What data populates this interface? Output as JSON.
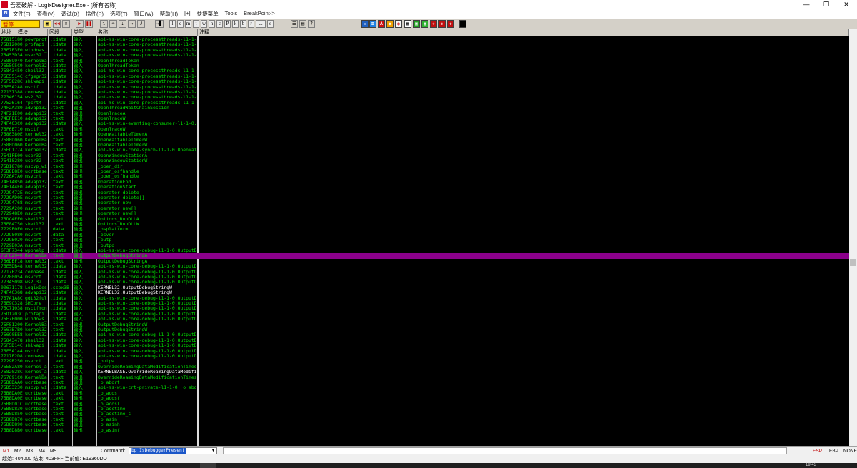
{
  "window": {
    "title": "吾爱破解 - LogixDesigner.Exe - [所有名称]",
    "minimize": "—",
    "maximize": "❐",
    "close": "✕"
  },
  "menu": {
    "logo": "N",
    "items": [
      "文件(F)",
      "查看(V)",
      "调试(D)",
      "插件(P)",
      "选项(T)",
      "窗口(W)",
      "帮助(H)",
      "[+]",
      "快捷菜单",
      "Tools",
      "BreakPoint->"
    ]
  },
  "toolbar": {
    "status": "暂停",
    "letters": [
      "l",
      "e",
      "m",
      "t",
      "w",
      "h",
      "c",
      "P",
      "k",
      "b",
      "r",
      "...",
      "s"
    ]
  },
  "columns": {
    "address": "地址",
    "module": "模块",
    "section": "区段",
    "type": "类型",
    "name": "名称",
    "comment": "注释"
  },
  "rows": [
    {
      "addr": "75815180",
      "mod": "powrprof",
      "sect": ".idata",
      "type": "输入",
      "name": "api-ms-win-core-processthreads-l1-1-0."
    },
    {
      "addr": "75D12000",
      "mod": "profapi",
      "sect": ".idata",
      "type": "输入",
      "name": "api-ms-win-core-processthreads-l1-1-0."
    },
    {
      "addr": "75E7F3F0",
      "mod": "windows_",
      "sect": ".idata",
      "type": "输入",
      "name": "api-ms-win-core-processthreads-l1-1-0."
    },
    {
      "addr": "75453D34",
      "mod": "user32",
      "sect": ".idata",
      "type": "输入",
      "name": "api-ms-win-core-processthreads-l1-1-0."
    },
    {
      "addr": "75809940",
      "mod": "KernelBa",
      "sect": ".text",
      "type": "输出",
      "name": "OpenThreadToken"
    },
    {
      "addr": "75E5C5C9",
      "mod": "kernel32",
      "sect": ".idata",
      "type": "输入",
      "name": "OpenThreadToken"
    },
    {
      "addr": "75843450",
      "mod": "shell32",
      "sect": ".idata",
      "type": "输入",
      "name": "api-ms-win-core-processthreads-l1-1-0."
    },
    {
      "addr": "75E5514C",
      "mod": "cfgmgr32",
      "sect": ".idata",
      "type": "输入",
      "name": "api-ms-win-core-processthreads-l1-1-0."
    },
    {
      "addr": "75F5828C",
      "mod": "shlwapi",
      "sect": ".idata",
      "type": "输入",
      "name": "api-ms-win-core-processthreads-l1-1-0."
    },
    {
      "addr": "75F5A2A8",
      "mod": "msctf",
      "sect": ".idata",
      "type": "输入",
      "name": "api-ms-win-core-processthreads-l1-1-0."
    },
    {
      "addr": "77137388",
      "mod": "combase",
      "sect": ".idata",
      "type": "输入",
      "name": "api-ms-win-core-processthreads-l1-1-0."
    },
    {
      "addr": "77346154",
      "mod": "ws2_32",
      "sect": ".idata",
      "type": "输入",
      "name": "api-ms-win-core-processthreads-l1-1-0."
    },
    {
      "addr": "77526164",
      "mod": "rpcrt4",
      "sect": ".idata",
      "type": "输入",
      "name": "api-ms-win-core-processthreads-l1-1-0."
    },
    {
      "addr": "74F2A380",
      "mod": "advapi32",
      "sect": ".text",
      "type": "输出",
      "name": "OpenThreadWaitChainSession"
    },
    {
      "addr": "74F21E00",
      "mod": "advapi32",
      "sect": ".text",
      "type": "输出",
      "name": "OpenTraceA"
    },
    {
      "addr": "74EFEE10",
      "mod": "advapi32",
      "sect": ".text",
      "type": "输出",
      "name": "OpenTraceW"
    },
    {
      "addr": "74F4C3C0",
      "mod": "advapi32",
      "sect": ".idata",
      "type": "输入",
      "name": "api-ms-win-eventing-consumer-l1-1-0.Op"
    },
    {
      "addr": "75F6E710",
      "mod": "msctf",
      "sect": ".text",
      "type": "输出",
      "name": "OpenTraceW"
    },
    {
      "addr": "7580380E",
      "mod": "kernel32",
      "sect": ".text",
      "type": "输出",
      "name": "OpenWaitableTimerA"
    },
    {
      "addr": "7580D060",
      "mod": "KernelBa",
      "sect": ".text",
      "type": "输出",
      "name": "OpenWaitableTimerW"
    },
    {
      "addr": "7580D060",
      "mod": "KernelBa",
      "sect": ".text",
      "type": "输出",
      "name": "OpenWaitableTimerW"
    },
    {
      "addr": "75EC1774",
      "mod": "kernel32",
      "sect": ".idata",
      "type": "输入",
      "name": "api-ms-win-core-synch-l1-1-0.OpenWaita"
    },
    {
      "addr": "7541FE00",
      "mod": "user32",
      "sect": ".text",
      "type": "输出",
      "name": "OpenWindowStationA"
    },
    {
      "addr": "75418280",
      "mod": "user32",
      "sect": ".text",
      "type": "输出",
      "name": "OpenWindowStationW"
    },
    {
      "addr": "75D18780",
      "mod": "mscvp_wi",
      "sect": ".text",
      "type": "输出",
      "name": "_open_dir"
    },
    {
      "addr": "75B8E8E0",
      "mod": "ucrtbase",
      "sect": ".text",
      "type": "输出",
      "name": "_open_osfhandle"
    },
    {
      "addr": "7726A7A0",
      "mod": "msvcrt",
      "sect": ".text",
      "type": "输出",
      "name": "_open_osfhandle"
    },
    {
      "addr": "74F14B50",
      "mod": "advapi32",
      "sect": ".text",
      "type": "输出",
      "name": "OperationEnd"
    },
    {
      "addr": "74F144E0",
      "mod": "advapi32",
      "sect": ".text",
      "type": "输出",
      "name": "OperationStart"
    },
    {
      "addr": "7729472E",
      "mod": "msvcrt",
      "sect": ".text",
      "type": "输出",
      "name": "operator delete"
    },
    {
      "addr": "7729AD0E",
      "mod": "msvcrt",
      "sect": ".text",
      "type": "输出",
      "name": "operator delete[]"
    },
    {
      "addr": "77294768",
      "mod": "msvcrt",
      "sect": ".text",
      "type": "输出",
      "name": "operator new"
    },
    {
      "addr": "7729A200",
      "mod": "msvcrt",
      "sect": ".text",
      "type": "输出",
      "name": "operator new[]"
    },
    {
      "addr": "772948E0",
      "mod": "msvcrt",
      "sect": ".text",
      "type": "输出",
      "name": "operator new[]"
    },
    {
      "addr": "75DC4EF0",
      "mod": "shell32",
      "sect": ".text",
      "type": "输出",
      "name": "Options_RunDLLA"
    },
    {
      "addr": "75E84750",
      "mod": "shell32",
      "sect": ".text",
      "type": "输出",
      "name": "Options_RunDLLW"
    },
    {
      "addr": "7729E0F0",
      "mod": "msvcrt",
      "sect": ".data",
      "type": "输出",
      "name": "_osplatform"
    },
    {
      "addr": "77298080",
      "mod": "msvcrt",
      "sect": ".data",
      "type": "输出",
      "name": "_osver"
    },
    {
      "addr": "7729B020",
      "mod": "msvcrt",
      "sect": ".text",
      "type": "输出",
      "name": "_outp"
    },
    {
      "addr": "7729B03A",
      "mod": "msvcrt",
      "sect": ".text",
      "type": "输出",
      "name": "_outpd"
    },
    {
      "addr": "6F3F7344",
      "mod": "wpphelp",
      "sect": ".idata",
      "type": "输入",
      "name": "api-ms-win-core-debug-l1-1-0.OutputDe"
    },
    {
      "addr": "75F02940",
      "mod": "KernelBa",
      "sect": ".text",
      "type": "输出",
      "name": "OutputDebugStringA",
      "selected": true
    },
    {
      "addr": "756DEF18",
      "mod": "kernel32",
      "sect": ".text",
      "type": "输出",
      "name": "OutputDebugStringA"
    },
    {
      "addr": "75E5DB48",
      "mod": "kernel32",
      "sect": ".idata",
      "type": "输入",
      "name": "api-ms-win-core-debug-l1-1-0.OutputDe"
    },
    {
      "addr": "7717F234",
      "mod": "combase",
      "sect": ".idata",
      "type": "输入",
      "name": "api-ms-win-core-debug-l1-1-0.OutputDe"
    },
    {
      "addr": "77280054",
      "mod": "msvcrt",
      "sect": ".idata",
      "type": "输入",
      "name": "api-ms-win-core-debug-l1-1-0.OutputDe"
    },
    {
      "addr": "77345098",
      "mod": "ws2_32",
      "sect": ".idata",
      "type": "输入",
      "name": "api-ms-win-core-debug-l1-1-0.OutputDe"
    },
    {
      "addr": "00671178",
      "mod": "LogixDes",
      "sect": ".scbx3B",
      "type": "输入",
      "name": "KERNEL32.OutputDebugStringW",
      "white": true
    },
    {
      "addr": "74F4C368",
      "mod": "advapi32",
      "sect": ".idata",
      "type": "输入",
      "name": "KERNEL32.OutputDebugStringW",
      "white": true
    },
    {
      "addr": "757A1A8C",
      "mod": "gdi32ful",
      "sect": ".idata",
      "type": "输入",
      "name": "api-ms-win-core-debug-l1-1-0.OutputDe"
    },
    {
      "addr": "75E9C328",
      "mod": "SHCore",
      "sect": ".idata",
      "type": "输入",
      "name": "api-ms-win-core-debug-l1-1-0.OutputDe"
    },
    {
      "addr": "75C71038",
      "mod": "msctfmon",
      "sect": ".idata",
      "type": "输入",
      "name": "api-ms-win-core-debug-l1-1-0.OutputDe"
    },
    {
      "addr": "75D1203C",
      "mod": "profapi",
      "sect": ".idata",
      "type": "输入",
      "name": "api-ms-win-core-debug-l1-1-0.OutputDe"
    },
    {
      "addr": "75E7F000",
      "mod": "windows_",
      "sect": ".idata",
      "type": "输入",
      "name": "api-ms-win-core-debug-l1-1-0.OutputDe"
    },
    {
      "addr": "75F81200",
      "mod": "KernelBa",
      "sect": ".text",
      "type": "输出",
      "name": "OutputDebugStringW"
    },
    {
      "addr": "7567B7B0",
      "mod": "kernel32",
      "sect": ".text",
      "type": "输出",
      "name": "OutputDebugStringW"
    },
    {
      "addr": "756C0EE8",
      "mod": "kernel32",
      "sect": ".idata",
      "type": "输入",
      "name": "api-ms-win-core-debug-l1-1-0.OutputDe"
    },
    {
      "addr": "75843478",
      "mod": "shell32",
      "sect": ".idata",
      "type": "输入",
      "name": "api-ms-win-core-debug-l1-1-0.OutputDe"
    },
    {
      "addr": "75F5D14C",
      "mod": "shlwapi",
      "sect": ".idata",
      "type": "输入",
      "name": "api-ms-win-core-debug-l1-1-0.OutputDe"
    },
    {
      "addr": "75F5A144",
      "mod": "msctf",
      "sect": ".idata",
      "type": "输入",
      "name": "api-ms-win-core-debug-l1-1-0.OutputDe"
    },
    {
      "addr": "7717F2D8",
      "mod": "combase",
      "sect": ".idata",
      "type": "输入",
      "name": "api-ms-win-core-debug-l1-1-0.OutputDe"
    },
    {
      "addr": "7729B250",
      "mod": "msvcrt",
      "sect": ".text",
      "type": "输出",
      "name": "_outpw"
    },
    {
      "addr": "75E52A80",
      "mod": "kernel_a",
      "sect": ".text",
      "type": "输出",
      "name": "OverrideRoamingDataModificationTimesIn"
    },
    {
      "addr": "7582028C",
      "mod": "kernel_a",
      "sect": ".idata",
      "type": "输入",
      "name": "KERNELBASE.OverrideRoamingDataModifica",
      "white": true
    },
    {
      "addr": "757691C0",
      "mod": "KernelBa",
      "sect": ".text",
      "type": "输出",
      "name": "OverrideRoamingDataModificationTimesIn"
    },
    {
      "addr": "75B8DAA0",
      "mod": "ucrtbase",
      "sect": ".text",
      "type": "输出",
      "name": "_o_abort"
    },
    {
      "addr": "75D53230",
      "mod": "mscvp_wi",
      "sect": ".idata",
      "type": "输入",
      "name": "api-ms-win-crt-private-l1-1-0._o_abor"
    },
    {
      "addr": "75B8DA0E",
      "mod": "ucrtbase",
      "sect": ".text",
      "type": "输出",
      "name": "_o_acos"
    },
    {
      "addr": "75B8DA0E",
      "mod": "ucrtbase",
      "sect": ".text",
      "type": "输出",
      "name": "_o_acosf"
    },
    {
      "addr": "75B8D01C",
      "mod": "ucrtbase",
      "sect": ".text",
      "type": "输出",
      "name": "_o_acosl"
    },
    {
      "addr": "75B8D830",
      "mod": "ucrtbase",
      "sect": ".text",
      "type": "输出",
      "name": "_o_asctime"
    },
    {
      "addr": "75B8D850",
      "mod": "ucrtbase",
      "sect": ".text",
      "type": "输出",
      "name": "_o_asctime_s"
    },
    {
      "addr": "75B8D870",
      "mod": "ucrtbase",
      "sect": ".text",
      "type": "输出",
      "name": "_o_asin"
    },
    {
      "addr": "75B8D890",
      "mod": "ucrtbase",
      "sect": ".text",
      "type": "输出",
      "name": "_o_asinh"
    },
    {
      "addr": "75B8D8B0",
      "mod": "ucrtbase",
      "sect": ".text",
      "type": "输出",
      "name": "_o_asinf"
    }
  ],
  "command_bar": {
    "tabs": [
      "M1",
      "M2",
      "M3",
      "M4",
      "M5"
    ],
    "label": "Command:",
    "value": "bp IsDebuggerPresent",
    "right": [
      "ESP",
      "EBP",
      "NONE"
    ]
  },
  "status_bar": {
    "text": "起始: 404000  结束: 403FFF  当前值: E19360DD"
  },
  "taskbar": {
    "clock": "19:43"
  }
}
